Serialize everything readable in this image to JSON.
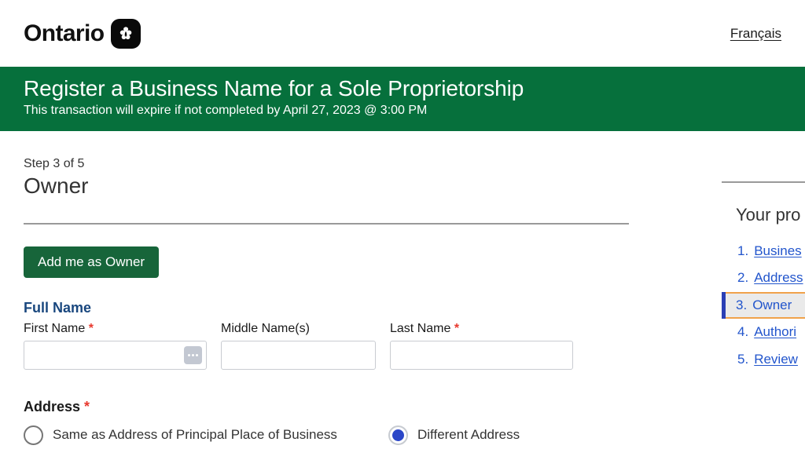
{
  "topbar": {
    "brand_word": "Ontario",
    "logo_icon": "trillium-icon",
    "language_link": "Français"
  },
  "banner": {
    "title": "Register a Business Name for a Sole Proprietorship",
    "subtitle": "This transaction will expire if not completed by April 27, 2023 @ 3:00 PM",
    "background_color": "#06703c"
  },
  "main": {
    "step_label": "Step 3 of 5",
    "step_title": "Owner",
    "add_owner_button": "Add me as Owner",
    "add_owner_button_color": "#17653a",
    "full_name": {
      "group_title": "Full Name",
      "group_title_color": "#19477e",
      "first_name": {
        "label": "First Name",
        "required_marker": "*",
        "value": "",
        "placeholder": "",
        "autofill_icon": "ellipsis-autofill-icon"
      },
      "middle_name": {
        "label": "Middle Name(s)",
        "required_marker": "",
        "value": "",
        "placeholder": ""
      },
      "last_name": {
        "label": "Last Name",
        "required_marker": "*",
        "value": "",
        "placeholder": ""
      }
    },
    "address": {
      "section_title": "Address",
      "required_marker": "*",
      "options": [
        {
          "label": "Same as Address of Principal Place of Business",
          "selected": false
        },
        {
          "label": "Different Address",
          "selected": true
        }
      ],
      "selected_color": "#2a46c8"
    }
  },
  "sidebar": {
    "title": "Your pro",
    "active_index": 3,
    "active_border_color": "#f0a24a",
    "active_bar_color": "#2a3fb5",
    "link_color": "#2255cc",
    "items": [
      {
        "num": "1.",
        "label": "Busines"
      },
      {
        "num": "2.",
        "label": "Address"
      },
      {
        "num": "3.",
        "label": "Owner"
      },
      {
        "num": "4.",
        "label": "Authori"
      },
      {
        "num": "5.",
        "label": "Review"
      }
    ]
  }
}
